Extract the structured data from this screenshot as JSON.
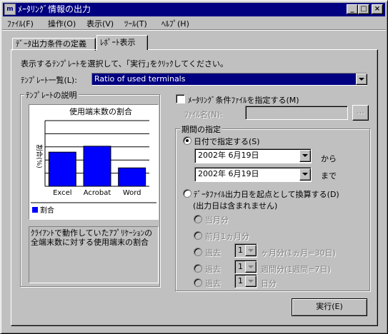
{
  "window": {
    "title": "ﾒｰﾀﾘﾝｸﾞ情報の出力",
    "app_icon": "meter-app-icon",
    "controls": [
      "_",
      "□",
      "×"
    ]
  },
  "menu": [
    "ﾌｧｲﾙ(F)",
    "操作(O)",
    "表示(V)",
    "ﾂｰﾙ(T)",
    "ﾍﾙﾌﾟ(H)"
  ],
  "tabs": [
    {
      "label": "ﾃﾞｰﾀ出力条件の定義",
      "active": false
    },
    {
      "label": "ﾚﾎﾟｰﾄ表示",
      "active": true
    }
  ],
  "instruction": "表示するﾃﾝﾌﾟﾚｰﾄを選択して、｢実行｣をｸﾘｯｸしてください。",
  "template_list": {
    "label": "ﾃﾝﾌﾟﾚｰﾄ一覧(L):",
    "selected": "Ratio of used terminals"
  },
  "template_desc": {
    "group_title": "ﾃﾝﾌﾟﾚｰﾄの説明",
    "description": "ｸﾗｲｱﾝﾄで動作していたｱﾌﾟﾘｹｰｼｮﾝの全端末数に対する使用端末の割合"
  },
  "chart_data": {
    "type": "bar",
    "title": "使用端末数の割合",
    "ylabel": "割合(%)",
    "categories": [
      "Excel",
      "Acrobat",
      "Word"
    ],
    "series": [
      {
        "name": "割合",
        "values": [
          52,
          61,
          28
        ]
      }
    ],
    "ylim": [
      0,
      100
    ],
    "grid": true,
    "legend": "bottom-left",
    "bar_color": "#0000ff"
  },
  "metering_file": {
    "checkbox_label": "ﾒｰﾀﾘﾝｸﾞ条件ﾌｧｲﾙを指定する(M)",
    "checked": false,
    "filename_label": "ﾌｧｲﾙ名(N):",
    "filename_value": "",
    "browse_label": "..."
  },
  "period": {
    "group_title": "期間の指定",
    "by_date_label": "日付で指定する(S)",
    "by_date_selected": true,
    "from_date": "2002年  6月19日",
    "from_suffix": "から",
    "to_date": "2002年  6月19日",
    "to_suffix": "まで",
    "relative_label": "ﾃﾞｰﾀﾌｧｲﾙ出力日を起点として換算する(D)",
    "relative_note": "(出力日は含まれません)",
    "options": [
      {
        "label": "当月分"
      },
      {
        "label": "前月1ヵ月分"
      },
      {
        "label": "過去",
        "value": "1",
        "unit": "ヶ月分(1ヵ月=30日)"
      },
      {
        "label": "過去",
        "value": "1",
        "unit": "週間分(1週間=7日)"
      },
      {
        "label": "過去",
        "value": "1",
        "unit": "日分"
      }
    ]
  },
  "run_button": "実行(E)"
}
